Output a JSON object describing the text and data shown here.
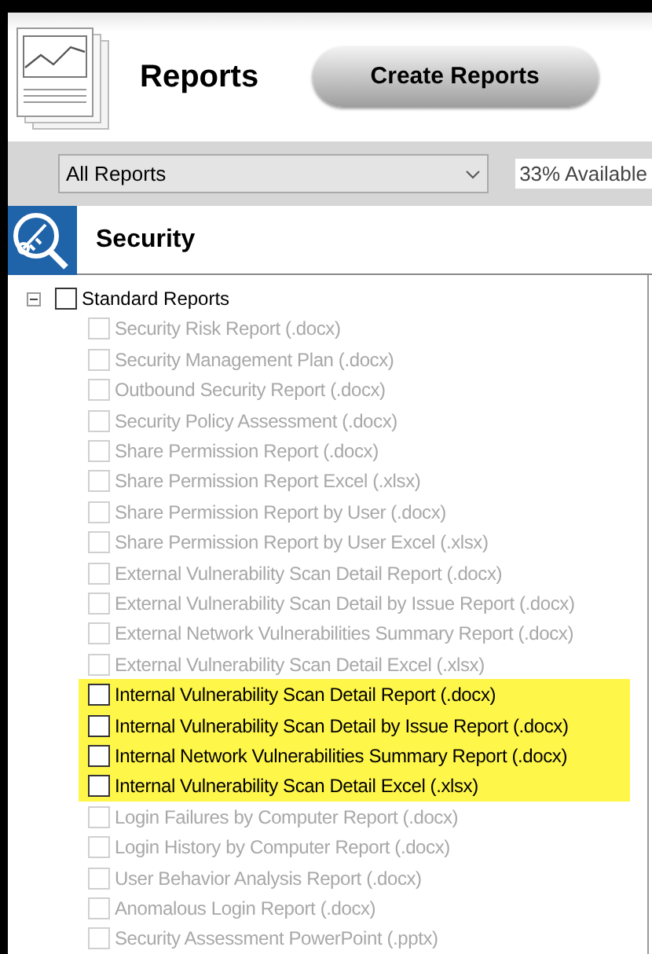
{
  "header": {
    "title": "Reports",
    "button": "Create Reports"
  },
  "filter": {
    "dropdown": "All Reports",
    "availability": "33% Available"
  },
  "section": {
    "title": "Security"
  },
  "tree": [
    {
      "label": "Standard Reports",
      "expanded": true,
      "checked": false,
      "children": [
        {
          "label": "Security Risk Report (.docx)",
          "checked": false,
          "disabled": true,
          "highlighted": false
        },
        {
          "label": "Security Management Plan (.docx)",
          "checked": false,
          "disabled": true,
          "highlighted": false
        },
        {
          "label": "Outbound Security Report (.docx)",
          "checked": false,
          "disabled": true,
          "highlighted": false
        },
        {
          "label": "Security Policy Assessment (.docx)",
          "checked": false,
          "disabled": true,
          "highlighted": false
        },
        {
          "label": "Share Permission Report (.docx)",
          "checked": false,
          "disabled": true,
          "highlighted": false
        },
        {
          "label": "Share Permission Report Excel (.xlsx)",
          "checked": false,
          "disabled": true,
          "highlighted": false
        },
        {
          "label": "Share Permission Report by User (.docx)",
          "checked": false,
          "disabled": true,
          "highlighted": false
        },
        {
          "label": "Share Permission Report by User Excel (.xlsx)",
          "checked": false,
          "disabled": true,
          "highlighted": false
        },
        {
          "label": "External Vulnerability Scan Detail Report (.docx)",
          "checked": false,
          "disabled": true,
          "highlighted": false
        },
        {
          "label": "External Vulnerability Scan Detail by Issue Report (.docx)",
          "checked": false,
          "disabled": true,
          "highlighted": false
        },
        {
          "label": "External Network Vulnerabilities Summary Report (.docx)",
          "checked": false,
          "disabled": true,
          "highlighted": false
        },
        {
          "label": "External Vulnerability Scan Detail Excel (.xlsx)",
          "checked": false,
          "disabled": true,
          "highlighted": false
        },
        {
          "label": "Internal Vulnerability Scan Detail Report (.docx)",
          "checked": false,
          "disabled": false,
          "highlighted": true
        },
        {
          "label": "Internal Vulnerability Scan Detail by Issue Report (.docx)",
          "checked": false,
          "disabled": false,
          "highlighted": true
        },
        {
          "label": "Internal Network Vulnerabilities Summary Report (.docx)",
          "checked": false,
          "disabled": false,
          "highlighted": true
        },
        {
          "label": "Internal Vulnerability Scan Detail Excel (.xlsx)",
          "checked": false,
          "disabled": false,
          "highlighted": true
        },
        {
          "label": "Login Failures by Computer Report (.docx)",
          "checked": false,
          "disabled": true,
          "highlighted": false
        },
        {
          "label": "Login History by Computer Report (.docx)",
          "checked": false,
          "disabled": true,
          "highlighted": false
        },
        {
          "label": "User Behavior Analysis Report (.docx)",
          "checked": false,
          "disabled": true,
          "highlighted": false
        },
        {
          "label": "Anomalous Login Report (.docx)",
          "checked": false,
          "disabled": true,
          "highlighted": false
        },
        {
          "label": "Security Assessment PowerPoint (.pptx)",
          "checked": false,
          "disabled": true,
          "highlighted": false
        }
      ]
    }
  ]
}
